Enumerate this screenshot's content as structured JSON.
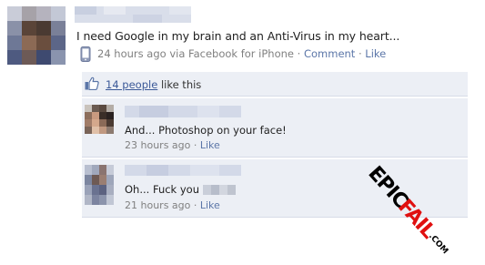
{
  "post": {
    "author_name": "",
    "text": "I need Google in my brain and an Anti-Virus in my heart...",
    "time": "24 hours ago via Facebook for iPhone",
    "separator": "·",
    "comment_link": "Comment",
    "like_link": "Like"
  },
  "likes": {
    "count_link": "14 people",
    "suffix": "like this"
  },
  "comments": [
    {
      "author_name": "",
      "text": "And... Photoshop on your face!",
      "time": "23 hours ago",
      "like_link": "Like"
    },
    {
      "author_name": "",
      "text": "Oh... Fuck you",
      "time": "21 hours ago",
      "like_link": "Like"
    }
  ],
  "watermark": {
    "part1": "EPIC",
    "part2": "FAIL",
    "part3": ".COM"
  },
  "colors": {
    "link": "#3b5998",
    "meta_link": "#5b76a8",
    "feedback_bg": "#eceff5",
    "watermark_red": "#e01010"
  },
  "icons": [
    "phone-icon",
    "thumbs-up-icon"
  ]
}
